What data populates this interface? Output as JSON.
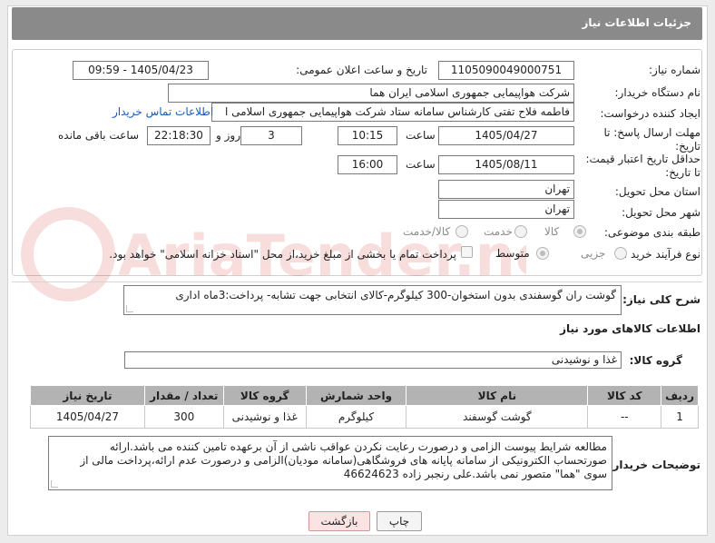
{
  "header": {
    "title": "جزئیات اطلاعات نیاز"
  },
  "form": {
    "need_number_label": "شماره نیاز:",
    "need_number": "1105090049000751",
    "announce_label": "تاریخ و ساعت اعلان عمومی:",
    "announce_value": "1405/04/23 - 09:59",
    "buyer_org_label": "نام دستگاه خریدار:",
    "buyer_org": "شرکت هواپیمایی جمهوری اسلامی ایران هما",
    "requester_label": "ایجاد کننده درخواست:",
    "requester": "فاطمه فلاح تفتی کارشناس سامانه ستاد شرکت هواپیمایی جمهوری اسلامی ا",
    "contact_link": "اطلاعات تماس خریدار",
    "reply_deadline_label": "مهلت ارسال پاسخ: تا تاریخ:",
    "reply_date": "1405/04/27",
    "time_label": "ساعت",
    "reply_time": "10:15",
    "days_value": "3",
    "days_label": "روز و",
    "remaining_time": "22:18:30",
    "remaining_label": "ساعت باقی مانده",
    "price_validity_label": "حداقل تاریخ اعتبار قیمت: تا تاریخ:",
    "price_date": "1405/08/11",
    "price_time": "16:00",
    "province_label": "استان محل تحویل:",
    "province": "تهران",
    "city_label": "شهر محل تحویل:",
    "city": "تهران",
    "category_label": "طبقه بندی موضوعی:",
    "category_options": [
      "کالا",
      "خدمت",
      "کالا/خدمت"
    ],
    "process_label": "نوع فرآیند خرید :",
    "process_options": [
      "جزیی",
      "متوسط"
    ],
    "payment_text": "پرداخت تمام یا بخشی از مبلغ خرید،از محل \"اسناد خزانه اسلامی\" خواهد بود."
  },
  "description": {
    "label": "شرح کلی نیاز:",
    "value": "گوشت ران گوسفندی بدون استخوان-300 کیلوگرم-کالای انتخابی جهت تشابه- پرداخت:3ماه اداری"
  },
  "items_section": {
    "title": "اطلاعات کالاهای مورد نیاز",
    "group_label": "گروه کالا:",
    "group_value": "غذا و نوشیدنی",
    "columns": [
      "ردیف",
      "کد کالا",
      "نام کالا",
      "واحد شمارش",
      "گروه کالا",
      "تعداد / مقدار",
      "تاریخ نیاز"
    ],
    "rows": [
      [
        "1",
        "--",
        "گوشت گوسفند",
        "کیلوگرم",
        "غذا و نوشیدنی",
        "300",
        "1405/04/27"
      ]
    ]
  },
  "buyer_notes": {
    "label": "توضیحات خریدار:",
    "value": "مطالعه شرایط پیوست الزامی و درصورت رعایت نکردن عواقب ناشی از آن برعهده تامین کننده می باشد.ارائه صورتحساب الکترونیکی از سامانه پایانه های فروشگاهی(سامانه مودیان)الزامی و درصورت عدم ارائه،پرداخت مالی از سوی \"هما\" متصور نمی باشد.علی رنجبر زاده 46624623"
  },
  "buttons": {
    "print": "چاپ",
    "back": "بازگشت"
  },
  "watermark_text": "AriaTender.neT",
  "colors": {
    "header": "#8a8a8a",
    "table_header": "#b3b3b3",
    "link": "#1a5bb8",
    "back_button": "#fbe3e3"
  }
}
